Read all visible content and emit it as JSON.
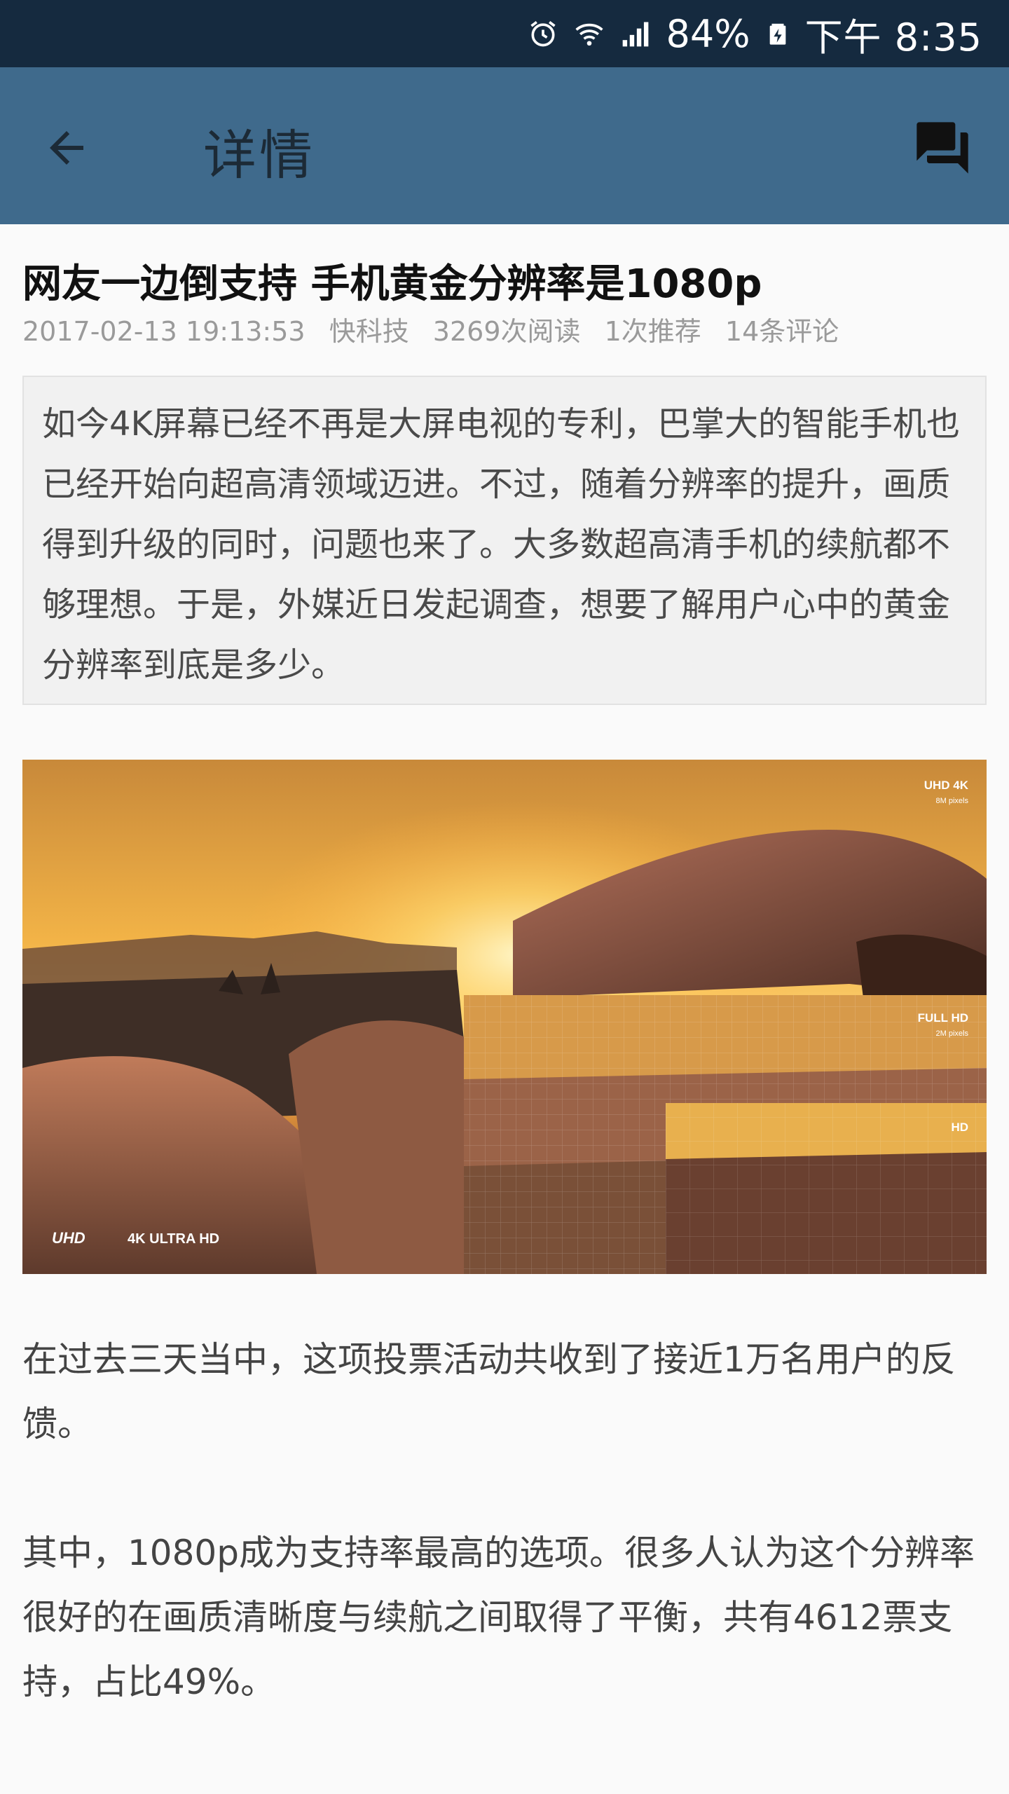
{
  "status_bar": {
    "battery_percent": "84%",
    "time": "下午 8:35",
    "icons": [
      "alarm-icon",
      "wifi-icon",
      "signal-icon",
      "battery-charging-icon"
    ]
  },
  "app_bar": {
    "title": "详情",
    "back_icon": "arrow-back-icon",
    "comments_icon": "forum-icon",
    "background_color": "#3f6a8c"
  },
  "article": {
    "title": "网友一边倒支持 手机黄金分辨率是1080p",
    "meta": {
      "datetime": "2017-02-13 19:13:53",
      "source": "快科技",
      "reads": "3269次阅读",
      "recommends": "1次推荐",
      "comments": "14条评论"
    },
    "summary": "如今4K屏幕已经不再是大屏电视的专利，巴掌大的智能手机也已经开始向超高清领域迈进。不过，随着分辨率的提升，画质得到升级的同时，问题也来了。大多数超高清手机的续航都不够理想。于是，外媒近日发起调查，想要了解用户心中的黄金分辨率到底是多少。",
    "image": {
      "labels": {
        "uhd": "UHD 4K",
        "uhd_sub": "8M pixels",
        "fullhd": "FULL HD",
        "fullhd_sub": "2M pixels",
        "hd": "HD",
        "logo_left": "UHD",
        "logo_right": "4K ULTRA HD"
      }
    },
    "paragraphs": [
      "在过去三天当中，这项投票活动共收到了接近1万名用户的反馈。",
      "其中，1080p成为支持率最高的选项。很多人认为这个分辨率很好的在画质清晰度与续航之间取得了平衡，共有4612票支持，占比49%。"
    ]
  }
}
